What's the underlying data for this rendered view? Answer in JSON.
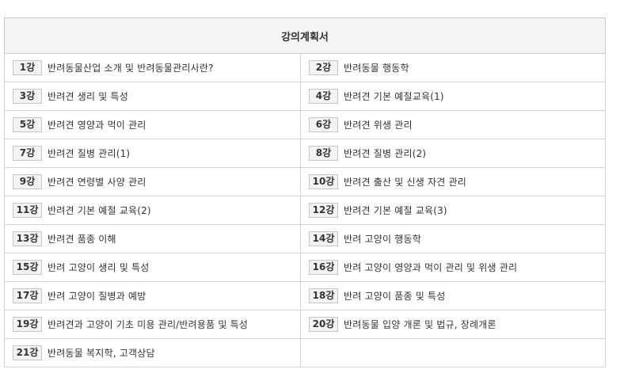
{
  "title": "강의계획서",
  "lectures": [
    {
      "num": "1강",
      "title": "반려동물산업 소개 및 반려동물관리사란?"
    },
    {
      "num": "2강",
      "title": "반려동물 행동학"
    },
    {
      "num": "3강",
      "title": "반려견 생리 및 특성"
    },
    {
      "num": "4강",
      "title": "반려견 기본 예절교육(1)"
    },
    {
      "num": "5강",
      "title": "반려견 영양과 먹이 관리"
    },
    {
      "num": "6강",
      "title": "반려견 위생 관리"
    },
    {
      "num": "7강",
      "title": "반려견 질병 관리(1)"
    },
    {
      "num": "8강",
      "title": "반려견 질병 관리(2)"
    },
    {
      "num": "9강",
      "title": "반려견 연령별 사양 관리"
    },
    {
      "num": "10강",
      "title": "반려견 출산 및 신생 자견 관리"
    },
    {
      "num": "11강",
      "title": "반려견 기본 예절 교육(2)"
    },
    {
      "num": "12강",
      "title": "반려견 기본 예절 교육(3)"
    },
    {
      "num": "13강",
      "title": "반려견 품종 이해"
    },
    {
      "num": "14강",
      "title": "반려 고양이 행동학"
    },
    {
      "num": "15강",
      "title": "반려 고양이 생리 및 특성"
    },
    {
      "num": "16강",
      "title": "반려 고양이 영양과 먹이 관리 및 위생 관리"
    },
    {
      "num": "17강",
      "title": "반려 고양이 질병과 예방"
    },
    {
      "num": "18강",
      "title": "반려 고양이 품종 및 특성"
    },
    {
      "num": "19강",
      "title": "반려견과 고양이 기초 미용 관리/반려용품 및 특성"
    },
    {
      "num": "20강",
      "title": "반려동물 입양 개론 및 법규, 장례개론"
    },
    {
      "num": "21강",
      "title": "반려동물 복지학, 고객상담"
    }
  ]
}
